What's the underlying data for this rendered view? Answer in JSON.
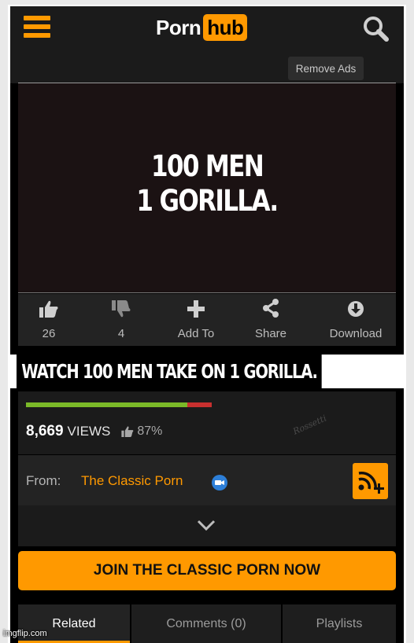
{
  "header": {
    "logo_part1": "Porn",
    "logo_part2": "hub",
    "menu_icon": "hamburger-menu-icon",
    "search_icon": "search-icon",
    "accent_color": "#ff9900"
  },
  "ads": {
    "remove_ads_label": "Remove Ads"
  },
  "video": {
    "caption_line1": "100 MEN",
    "caption_line2": "1 GORILLA."
  },
  "actions": [
    {
      "icon": "thumbs-up-icon",
      "label": "26"
    },
    {
      "icon": "thumbs-down-icon",
      "label": "4"
    },
    {
      "icon": "plus-icon",
      "label": "Add To"
    },
    {
      "icon": "share-icon",
      "label": "Share"
    },
    {
      "icon": "download-icon",
      "label": "Download"
    }
  ],
  "title_banner": "WATCH 100 MEN TAKE ON 1 GORILLA.",
  "stats": {
    "views_count": "8,669",
    "views_label": "VIEWS",
    "rating_percent": "87%",
    "rating_fraction": 0.87,
    "good_color": "#7bb928",
    "bad_color": "#c8302f"
  },
  "channel": {
    "from_label": "From:",
    "name": "The Classic Porn",
    "verified_icon": "camera-badge-icon",
    "subscribe_icon": "rss-plus-icon"
  },
  "expand": {
    "icon": "chevron-down-icon"
  },
  "join_button_label": "JOIN THE CLASSIC PORN NOW",
  "tabs": [
    {
      "label": "Related",
      "active": true
    },
    {
      "label": "Comments (0)",
      "active": false
    },
    {
      "label": "Playlists",
      "active": false
    }
  ],
  "footer": {
    "imgflip_label": "imgflip.com"
  }
}
